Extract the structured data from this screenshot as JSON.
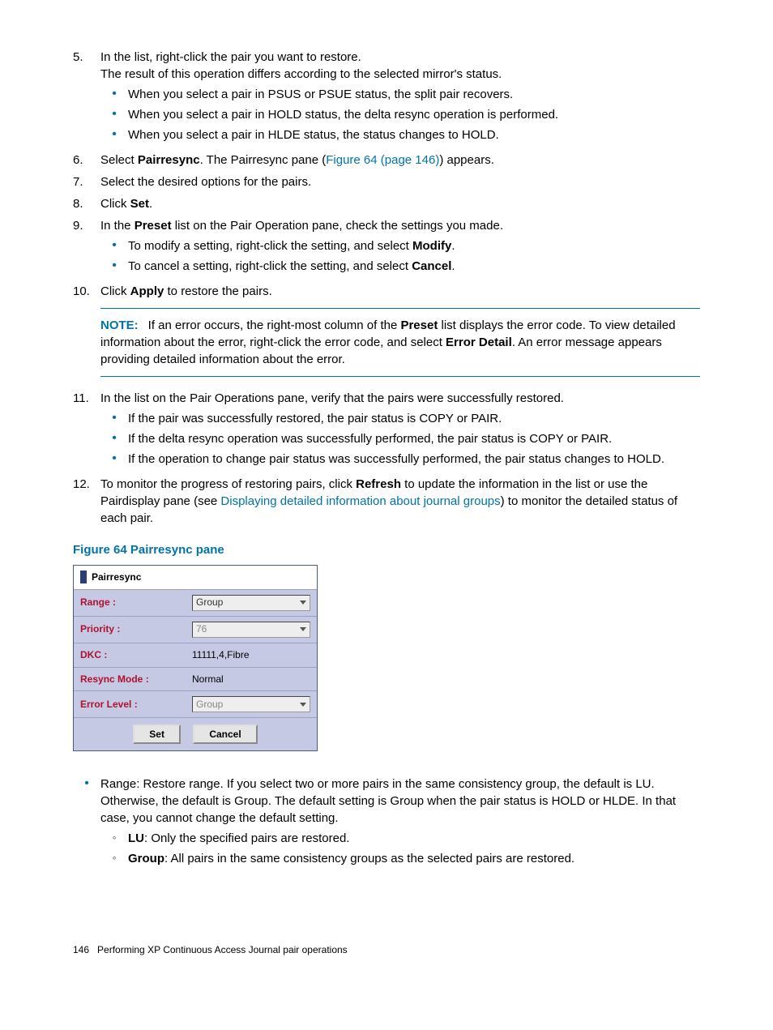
{
  "steps": {
    "s5": {
      "num": "5.",
      "line1": "In the list, right-click the pair you want to restore.",
      "line2": "The result of this operation differs according to the selected mirror's status.",
      "bul": [
        "When you select a pair in PSUS or PSUE status, the split pair recovers.",
        "When you select a pair in HOLD status, the delta resync operation is performed.",
        "When you select a pair in HLDE status, the status changes to HOLD."
      ]
    },
    "s6": {
      "num": "6.",
      "pre": "Select ",
      "bold": "Pairresync",
      "mid": ". The Pairresync pane (",
      "link": "Figure 64 (page 146)",
      "post": ") appears."
    },
    "s7": {
      "num": "7.",
      "text": "Select the desired options for the pairs."
    },
    "s8": {
      "num": "8.",
      "pre": "Click ",
      "bold": "Set",
      "post": "."
    },
    "s9": {
      "num": "9.",
      "pre": "In the ",
      "bold": "Preset",
      "post": " list on the Pair Operation pane, check the settings you made.",
      "bul": [
        {
          "pre": "To modify a setting, right-click the setting, and select ",
          "bold": "Modify",
          "post": "."
        },
        {
          "pre": "To cancel a setting, right-click the setting, and select ",
          "bold": "Cancel",
          "post": "."
        }
      ]
    },
    "s10": {
      "num": "10.",
      "pre": "Click ",
      "bold": "Apply",
      "post": " to restore the pairs."
    },
    "note": {
      "label": "NOTE:",
      "pre": "If an error occurs, the right-most column of the ",
      "bold1": "Preset",
      "mid": " list displays the error code. To view detailed information about the error, right-click the error code, and select ",
      "bold2": "Error Detail",
      "post": ". An error message appears providing detailed information about the error."
    },
    "s11": {
      "num": "11.",
      "text": "In the list on the Pair Operations pane, verify that the pairs were successfully restored.",
      "bul": [
        "If the pair was successfully restored, the pair status is COPY or PAIR.",
        "If the delta resync operation was successfully performed, the pair status is COPY or PAIR.",
        "If the operation to change pair status was successfully performed, the pair status changes to HOLD."
      ]
    },
    "s12": {
      "num": "12.",
      "pre": "To monitor the progress of restoring pairs, click ",
      "bold": "Refresh",
      "mid": " to update the information in the list or use the Pairdisplay pane (see ",
      "link": "Displaying detailed information about journal groups",
      "post": ") to monitor the detailed status of each pair."
    }
  },
  "figure": {
    "caption": "Figure 64 Pairresync pane",
    "title": "Pairresync",
    "rows": {
      "range": {
        "label": "Range :",
        "value": "Group"
      },
      "priority": {
        "label": "Priority :",
        "value": "76"
      },
      "dkc": {
        "label": "DKC :",
        "value": "11111,4,Fibre"
      },
      "resync": {
        "label": "Resync Mode :",
        "value": "Normal"
      },
      "error": {
        "label": "Error Level :",
        "value": "Group"
      }
    },
    "buttons": {
      "set": "Set",
      "cancel": "Cancel"
    }
  },
  "after": {
    "range_desc": "Range: Restore range. If you select two or more pairs in the same consistency group, the default is LU. Otherwise, the default is Group. The default setting is Group when the pair status is HOLD or HLDE. In that case, you cannot change the default setting.",
    "lu": {
      "bold": "LU",
      "post": ": Only the specified pairs are restored."
    },
    "group": {
      "bold": "Group",
      "post": ": All pairs in the same consistency groups as the selected pairs are restored."
    }
  },
  "footer": {
    "page": "146",
    "title": "Performing XP Continuous Access Journal pair operations"
  }
}
